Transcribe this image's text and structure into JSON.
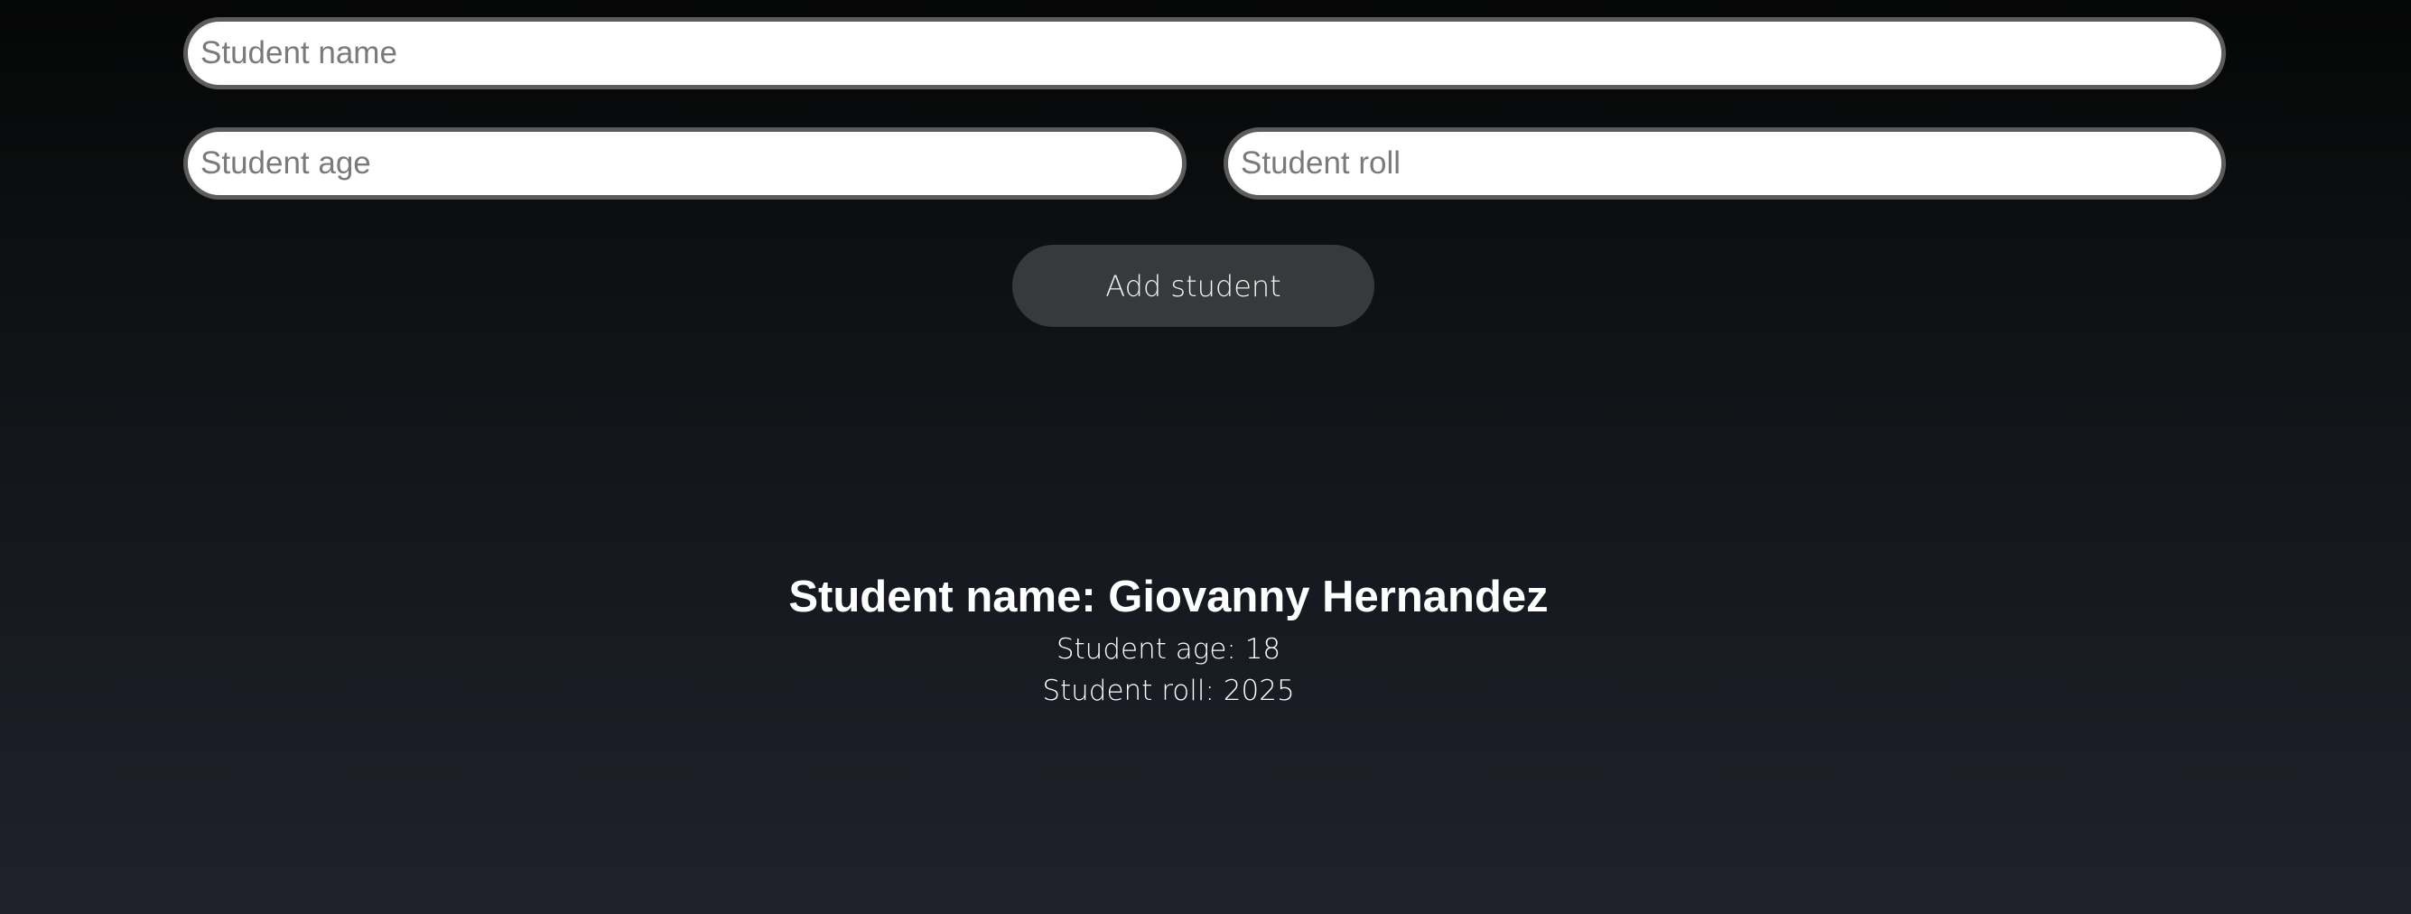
{
  "form": {
    "name_placeholder": "Student name",
    "age_placeholder": "Student age",
    "roll_placeholder": "Student roll",
    "add_button_label": "Add student"
  },
  "student": {
    "name_line": "Student name: Giovanny Hernandez",
    "age_line": "Student age: 18",
    "roll_line": "Student roll: 2025"
  },
  "colors": {
    "background_top": "#050606",
    "background_bottom": "#20212b",
    "input_border": "#5c5c5c",
    "button_bg": "#363a3b"
  }
}
